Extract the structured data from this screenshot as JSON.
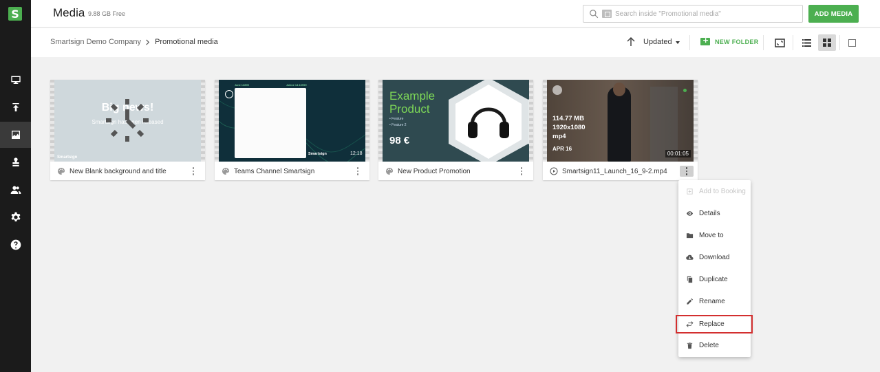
{
  "header": {
    "title": "Media",
    "free_space": "9.88 GB Free",
    "search_placeholder": "Search inside \"Promotional media\"",
    "add_button": "ADD MEDIA"
  },
  "breadcrumb": {
    "root": "Smartsign Demo Company",
    "current": "Promotional media"
  },
  "toolbar": {
    "sort_label": "Updated",
    "new_folder": "NEW FOLDER"
  },
  "cards": [
    {
      "name": "New Blank background and title",
      "thumb_title": "Big news!",
      "thumb_sub": "Smartsign has been released",
      "thumb_brand": "Smartsign"
    },
    {
      "name": "Teams Channel Smartsign",
      "thumb_top_left": "Jone 12899",
      "thumb_top_right": "Jolene 14:10999",
      "thumb_brand": "Smartsign",
      "thumb_time": "12:18"
    },
    {
      "name": "New Product Promotion",
      "thumb_title_1": "Example",
      "thumb_title_2": "Product",
      "thumb_feature_1": "• Feature",
      "thumb_feature_2": "• Feature 2",
      "thumb_price": "98 €"
    },
    {
      "name": "Smartsign11_Launch_16_9-2.mp4",
      "size": "114.77 MB",
      "resolution": "1920x1080",
      "format": "mp4",
      "date": "APR 16",
      "duration": "00:01:05"
    }
  ],
  "context_menu": {
    "items": [
      {
        "label": "Add to Booking",
        "icon": "booking-icon",
        "disabled": true
      },
      {
        "label": "Details",
        "icon": "eye-icon"
      },
      {
        "label": "Move to",
        "icon": "folder-icon"
      },
      {
        "label": "Download",
        "icon": "cloud-download-icon"
      },
      {
        "label": "Duplicate",
        "icon": "copy-icon"
      },
      {
        "label": "Rename",
        "icon": "pencil-icon"
      },
      {
        "label": "Replace",
        "icon": "swap-icon",
        "highlighted": true
      },
      {
        "label": "Delete",
        "icon": "trash-icon"
      }
    ]
  },
  "colors": {
    "accent": "#4caf50",
    "rail": "#1b1b1b",
    "highlight": "#d32f2f"
  }
}
